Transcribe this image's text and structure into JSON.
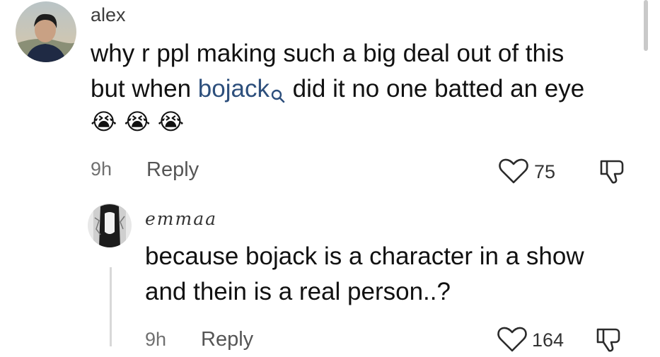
{
  "comment": {
    "username": "alex",
    "text_line1": "why r ppl making such a big deal out of this",
    "text_line2_before": "but when ",
    "link_text": "bojack",
    "text_line2_after": " did it no one batted an eye",
    "emoji": [
      "😭",
      "😭",
      "😭"
    ],
    "time": "9h",
    "reply_label": "Reply",
    "like_count": "75"
  },
  "reply": {
    "username": "emmaa",
    "text_line1": "because bojack is a character in a show",
    "text_line2": "and thein is a real person..?",
    "time": "9h",
    "reply_label": "Reply",
    "like_count": "164"
  },
  "colors": {
    "link": "#2d4f7c",
    "text": "#111111",
    "muted": "#707070"
  }
}
